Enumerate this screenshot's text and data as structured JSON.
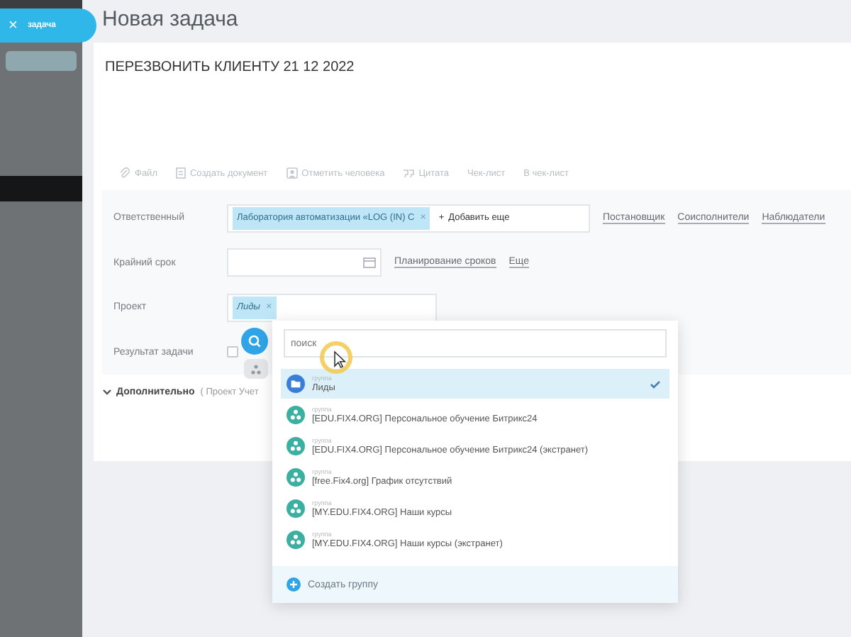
{
  "close_tab": {
    "icon": "×",
    "label": "задача"
  },
  "title": "Новая задача",
  "task_title": "ПЕРЕЗВОНИТЬ КЛИЕНТУ 21 12 2022",
  "toolbar": [
    {
      "kind": "file",
      "label": "Файл"
    },
    {
      "kind": "document",
      "label": "Создать документ"
    },
    {
      "kind": "person",
      "label": "Отметить человека"
    },
    {
      "kind": "quote",
      "label": "Цитата"
    },
    {
      "kind": "plain",
      "label": "Чек-лист"
    },
    {
      "kind": "plain",
      "label": "В чек-лист"
    }
  ],
  "responsible": {
    "label": "Ответственный",
    "chip": "Лаборатория автоматизации «LOG (IN) C",
    "chip_remove": "×",
    "add_icon": "+",
    "add_label": "Добавить еще",
    "links": [
      "Постановщик",
      "Соисполнители",
      "Наблюдатели"
    ]
  },
  "deadline": {
    "label": "Крайний срок",
    "links": [
      "Планирование сроков",
      "Еще"
    ]
  },
  "project": {
    "label": "Проект",
    "chip": "Лиды",
    "chip_remove": "×"
  },
  "result": {
    "label": "Результат задачи",
    "checked": false
  },
  "more": {
    "label": "Дополнительно",
    "hint": "( Проект  Учет"
  },
  "popup": {
    "search_placeholder": "поиск",
    "items": [
      {
        "kind": "project",
        "type": "группа",
        "name": "Лиды",
        "selected": true
      },
      {
        "kind": "group",
        "type": "группа",
        "name": "[EDU.FIX4.ORG] Персональное обучение Битрикс24",
        "selected": false
      },
      {
        "kind": "group",
        "type": "группа",
        "name": "[EDU.FIX4.ORG] Персональное обучение Битрикс24 (экстранет)",
        "selected": false
      },
      {
        "kind": "group",
        "type": "группа",
        "name": "[free.Fix4.org] График отсутствий",
        "selected": false
      },
      {
        "kind": "group",
        "type": "группа",
        "name": "[MY.EDU.FIX4.ORG] Наши курсы",
        "selected": false
      },
      {
        "kind": "group",
        "type": "группа",
        "name": "[MY.EDU.FIX4.ORG] Наши курсы (экстранет)",
        "selected": false
      }
    ],
    "create_label": "Создать группу"
  }
}
